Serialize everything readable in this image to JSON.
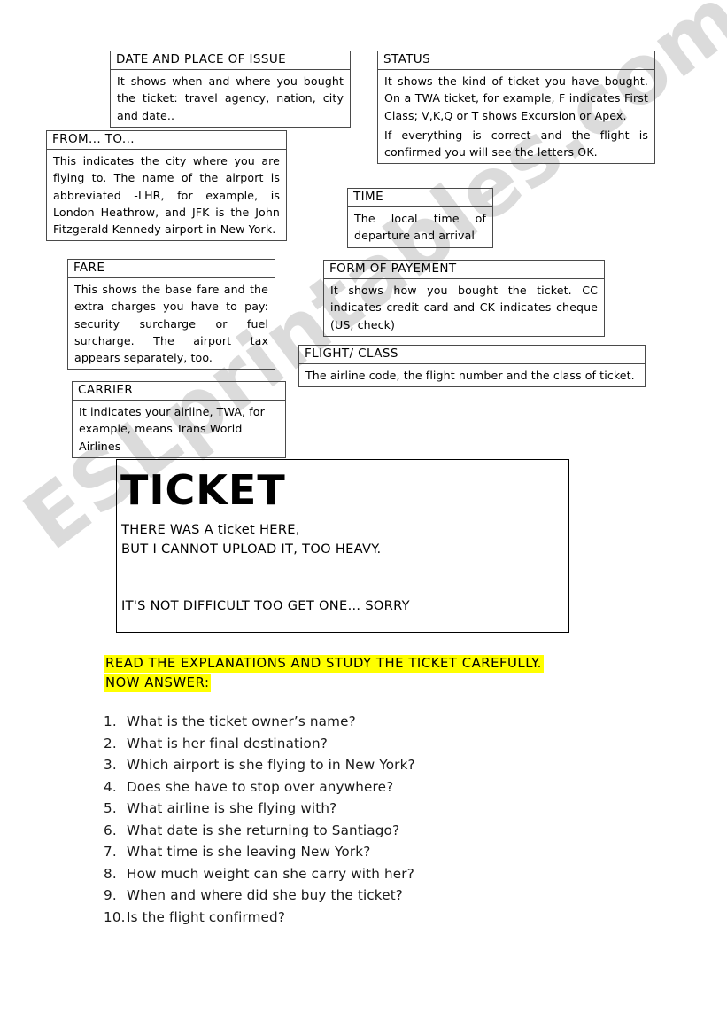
{
  "watermark": {
    "text": "ESLprintables.com"
  },
  "explanations": [
    {
      "id": "date-and-place-of-issue",
      "title": "DATE AND PLACE OF ISSUE",
      "body": "It shows when and where you bought the ticket: travel agency, nation, city and date.."
    },
    {
      "id": "status",
      "title": "STATUS",
      "body": "It shows the kind of ticket you have bought. On a TWA ticket, for example, F indicates First Class; V,K,Q or T shows Excursion or Apex.",
      "body2": "If everything is correct and the flight is confirmed you will see the letters OK."
    },
    {
      "id": "from-to",
      "title": "FROM... TO...",
      "body": "This indicates the city where you are flying to. The name of the airport is abbreviated -LHR, for example, is London Heathrow, and JFK is the John Fitzgerald Kennedy airport in New York."
    },
    {
      "id": "time",
      "title": "TIME",
      "body": "The local time of departure and arrival"
    },
    {
      "id": "fare",
      "title": "FARE",
      "body": "This shows the base fare and the extra charges you have to pay: security surcharge or fuel surcharge. The airport tax appears separately, too."
    },
    {
      "id": "form-of-payement",
      "title": "FORM OF PAYEMENT",
      "body": "It shows how you bought the ticket. CC indicates credit card and CK indicates cheque (US, check)"
    },
    {
      "id": "flight-class",
      "title": "FLIGHT/ CLASS",
      "body": "The airline code, the flight number and the class of ticket."
    },
    {
      "id": "carrier",
      "title": "CARRIER",
      "body": "It indicates your airline, TWA, for example, means Trans World Airlines"
    }
  ],
  "ticket": {
    "title": "TICKET",
    "line1": "THERE WAS A ticket HERE,",
    "line2": "BUT I CANNOT UPLOAD IT, TOO HEAVY.",
    "line3": "IT'S NOT DIFFICULT TOO GET ONE… SORRY"
  },
  "instructions": {
    "line1": "READ THE EXPLANATIONS AND STUDY THE TICKET CAREFULLY.",
    "line2": "NOW ANSWER:",
    "highlight_color": "#ffff00"
  },
  "questions": [
    {
      "num": "1.",
      "text": "What is the ticket owner’s name?"
    },
    {
      "num": "2.",
      "text": "What is her final destination?"
    },
    {
      "num": "3.",
      "text": "Which airport is she flying to in New York?"
    },
    {
      "num": "4.",
      "text": "Does she have to stop over anywhere?"
    },
    {
      "num": "5.",
      "text": "What airline is she flying with?"
    },
    {
      "num": "6.",
      "text": "What date is she returning to Santiago?"
    },
    {
      "num": "7.",
      "text": "What time is she leaving New York?"
    },
    {
      "num": "8.",
      "text": "How much weight can she carry with her?"
    },
    {
      "num": "9.",
      "text": "When and where did she buy the ticket?"
    },
    {
      "num": "10.",
      "text": "Is the flight confirmed?"
    }
  ]
}
